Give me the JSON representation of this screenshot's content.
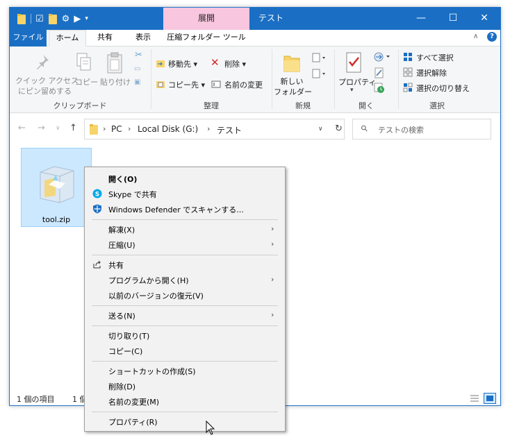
{
  "titlebar": {
    "context_tab": "展開",
    "title": "テスト",
    "minimize": "—",
    "maximize": "☐",
    "close": "✕"
  },
  "tabs": {
    "file": "ファイル",
    "home": "ホーム",
    "share": "共有",
    "view": "表示",
    "zip_tools": "圧縮フォルダー ツール",
    "help": "?"
  },
  "ribbon": {
    "clipboard": {
      "pin_label_1": "クイック アクセス",
      "pin_label_2": "にピン留めする",
      "copy": "コピー",
      "paste": "貼り付け",
      "group": "クリップボード"
    },
    "organize": {
      "move_to": "移動先 ▾",
      "copy_to": "コピー先 ▾",
      "delete": "削除 ▾",
      "rename": "名前の変更",
      "group": "整理"
    },
    "new": {
      "new_folder_1": "新しい",
      "new_folder_2": "フォルダー",
      "group": "新規"
    },
    "open": {
      "properties": "プロパティ",
      "group": "開く"
    },
    "select": {
      "select_all": "すべて選択",
      "select_none": "選択解除",
      "invert": "選択の切り替え",
      "group": "選択"
    }
  },
  "address": {
    "parts": [
      "PC",
      "Local Disk (G:)",
      "テスト"
    ]
  },
  "search": {
    "placeholder": "テストの検索"
  },
  "file": {
    "name": "tool.zip"
  },
  "status": {
    "items": "1 個の項目",
    "selected": "1 個"
  },
  "context_menu": {
    "items": [
      "開く(O)",
      "Skype で共有",
      "Windows Defender でスキャンする...",
      "解凍(X)",
      "圧縮(U)",
      "共有",
      "プログラムから開く(H)",
      "以前のバージョンの復元(V)",
      "送る(N)",
      "切り取り(T)",
      "コピー(C)",
      "ショートカットの作成(S)",
      "削除(D)",
      "名前の変更(M)",
      "プロパティ(R)"
    ]
  },
  "colors": {
    "titlebar": "#1a6fc4",
    "context_tab": "#f9c6df",
    "selection": "#cce8ff",
    "menu_bg": "#f2f2f2"
  }
}
